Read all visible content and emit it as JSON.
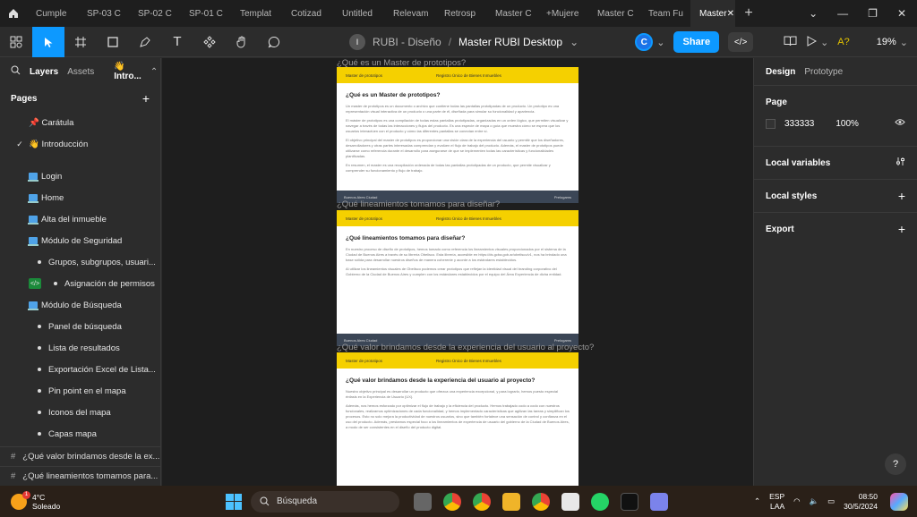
{
  "tabs": [
    "Cumple",
    "SP-03 C",
    "SP-02 C",
    "SP-01 C",
    "Templat",
    "Cotizad",
    "Untitled",
    "Relevam",
    "Retrosp",
    "Master C",
    "+Mujere",
    "Master C",
    "Team Fu",
    "Master"
  ],
  "active_tab_index": 13,
  "toolbar": {
    "project": "RUBI - Diseño",
    "separator": "/",
    "file_name": "Master RUBI Desktop",
    "avatar_letter": "C",
    "share_label": "Share",
    "code_label": "</>",
    "ai_label": "A?",
    "zoom": "19%"
  },
  "left": {
    "tab_layers": "Layers",
    "tab_assets": "Assets",
    "current_page": "👋 Intro...",
    "pages_header": "Pages",
    "pages": [
      {
        "label": "📌 Carátula",
        "kind": "plain"
      },
      {
        "label": "👋 Introducción",
        "kind": "current"
      },
      {
        "label": "",
        "kind": "spacer"
      },
      {
        "label": "Login",
        "kind": "screen"
      },
      {
        "label": "Home",
        "kind": "screen"
      },
      {
        "label": "Alta del inmueble",
        "kind": "screen"
      },
      {
        "label": "Módulo de Seguridad",
        "kind": "screen"
      },
      {
        "label": "Grupos, subgrupos, usuari...",
        "kind": "sub"
      },
      {
        "label": "Asignación de permisos",
        "kind": "subcode"
      },
      {
        "label": "Módulo de Búsqueda",
        "kind": "screen"
      },
      {
        "label": "Panel de búsqueda",
        "kind": "sub"
      },
      {
        "label": "Lista de resultados",
        "kind": "sub"
      },
      {
        "label": "Exportación Excel de Lista...",
        "kind": "sub"
      },
      {
        "label": "Pin point en el mapa",
        "kind": "sub"
      },
      {
        "label": "Iconos del mapa",
        "kind": "sub"
      },
      {
        "label": "Capas mapa",
        "kind": "sub"
      }
    ],
    "frames": [
      "¿Qué valor brindamos desde la ex...",
      "¿Qué lineamientos tomamos para..."
    ]
  },
  "canvas": {
    "frames": [
      {
        "label": "¿Qué es un Master de prototipos?",
        "header_left": "Master de prototipos",
        "header_right": "Registro Único de Bienes Inmuebles",
        "title": "¿Qué es un Master de prototipos?",
        "paragraphs": [
          "Un master de prototipos es un documento o archivo que contiene todas las pantallas prototipadas de un producto. Un prototipo es una representación visual interactiva de un producto o una parte de él, diseñada para simular su funcionalidad y apariencia.",
          "El máster de prototipos es una compilación de todas estas pantallas prototipadas, organizadas en un orden lógico, que permiten visualizar y navegar a través de todas las interacciones y flujos del producto. Es una especie de mapa o guía que muestra cómo se espera que los usuarios interactúen con el producto y cómo las diferentes pantallas se conectan entre sí.",
          "El objetivo principal del master de prototipos es proporcionar una visión clara de la experiencia del usuario y permitir que los diseñadores, desarrolladores y otras partes interesadas comprendan y evalúen el flujo de trabajo del producto. Además, el master de prototipos puede utilizarse como referencia durante el desarrollo para asegurarse de que se implementen todas las características y funcionalidades planificadas.",
          "En resumen, el master es una recopilación ordenada de todas las pantallas prototipadas de un producto, que permite visualizar y comprender su funcionamiento y flujo de trabajo."
        ],
        "footer_left": "Buenos Aires Ciudad",
        "footer_right": "Prelogams"
      },
      {
        "label": "¿Qué lineamientos tomamos para diseñar?",
        "header_left": "Master de prototipos",
        "header_right": "Registro Único de Bienes Inmuebles",
        "title": "¿Qué lineamientos tomamos para diseñar?",
        "paragraphs": [
          "En nuestro proceso de diseño de prototipos, hemos tomado como referencia los lineamientos visuales proporcionados por el sistema de la Ciudad de Buenos Aires a través de su librería Obelisco. Esta librería, accesible en https://ds.gcba.gob.ar/obelisco/v1, nos ha brindado una base sólida para desarrollar nuestros diseños de manera coherente y acorde a los estándares establecidos.",
          "Al utilizar los lineamientos visuales de Obelisco podemos crear prototipos que reflejan la identidad visual del branding corporativo del Gobierno de la Ciudad de Buenos Aires y cumplen con los estándares establecidos por el equipo del Área Experiencia de dicha entidad."
        ],
        "footer_left": "Buenos Aires Ciudad",
        "footer_right": "Prelogams"
      },
      {
        "label": "¿Qué valor brindamos desde la experiencia del usuario al proyecto?",
        "header_left": "Master de prototipos",
        "header_right": "Registro Único de Bienes Inmuebles",
        "title": "¿Qué valor brindamos desde la experiencia del usuario al proyecto?",
        "paragraphs": [
          "Nuestro objetivo principal es desarrollar un producto que ofrezca una experiencia excepcional, y para lograrlo, hemos puesto especial énfasis en la Experiencia de Usuario (UX).",
          "Además, nos hemos esforzado por optimizar el flujo de trabajo y la eficiencia del producto. Hemos trabajado codo a codo con nuestros funcionales, realizamos optimizaciones de cada funcionalidad, y hemos implementado características que agilizan las tareas y simplifican los procesos. Esto no solo mejora la productividad de nuestros usuarios, sino que también fortalece una sensación de control y confianza en el uso del producto. Además, prestamos especial foco a los lineamientos de experiencia de usuario del gobierno de la Ciudad de Buenos Aires, a modo de ser consistentes en el diseño del producto digital."
        ],
        "footer_left": "",
        "footer_right": ""
      }
    ]
  },
  "right": {
    "tab_design": "Design",
    "tab_prototype": "Prototype",
    "page_title": "Page",
    "bg_hex": "333333",
    "bg_opacity": "100%",
    "local_variables": "Local variables",
    "local_styles": "Local styles",
    "export": "Export",
    "help": "?"
  },
  "taskbar": {
    "temp": "4°C",
    "weather": "Soleado",
    "weather_badge": "1",
    "search_placeholder": "Búsqueda",
    "lang_top": "ESP",
    "lang_bottom": "LAA",
    "time": "08:50",
    "date": "30/5/2024"
  },
  "colors": {
    "accent": "#0d99ff",
    "frame_header": "#f5d000",
    "frame_footer": "#3b4656"
  }
}
